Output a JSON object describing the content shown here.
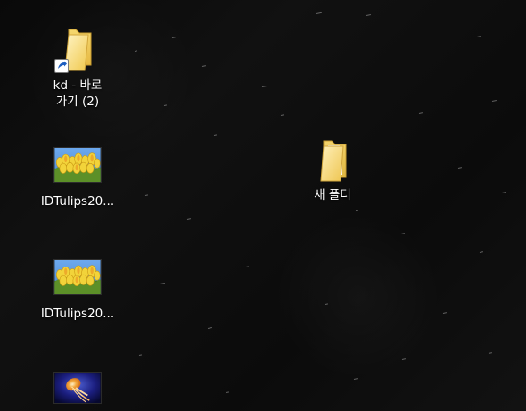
{
  "desktop": {
    "icons": [
      {
        "label": "kd - 바로\n가기 (2)",
        "icon": "shortcut-folder-icon"
      },
      {
        "label": "IDTulips20...",
        "icon": "tulips-image-icon"
      },
      {
        "label": "IDTulips20...",
        "icon": "tulips-image-icon"
      },
      {
        "label": "",
        "icon": "jellyfish-image-icon"
      },
      {
        "label": "새 폴더",
        "icon": "folder-icon"
      }
    ]
  }
}
